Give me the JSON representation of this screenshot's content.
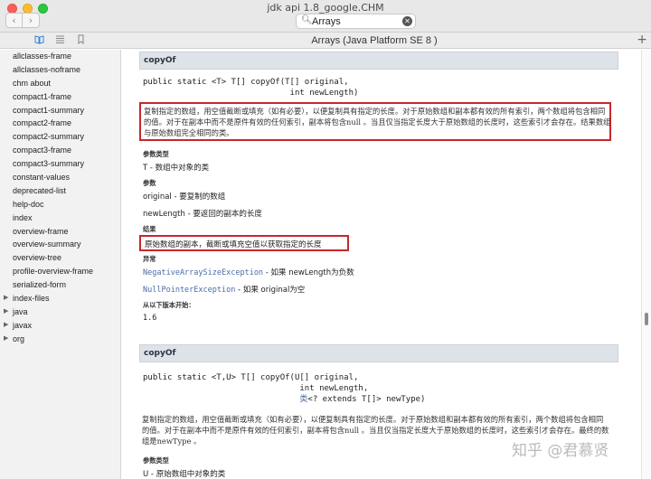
{
  "window": {
    "title": "jdk api 1.8_google.CHM",
    "traffic_light_colors": [
      "#ff5f57",
      "#febc2e",
      "#28c840"
    ]
  },
  "toolbar": {
    "back_glyph": "‹",
    "forward_glyph": "›",
    "search_value": "Arrays",
    "search_icon": "search-icon",
    "clear_icon": "clear-icon"
  },
  "tabbar": {
    "page_title": "Arrays (Java Platform SE 8 )",
    "add_glyph": "+"
  },
  "sidebar": {
    "items": [
      {
        "label": "allclasses-frame",
        "expandable": false
      },
      {
        "label": "allclasses-noframe",
        "expandable": false
      },
      {
        "label": "chm about",
        "expandable": false
      },
      {
        "label": "compact1-frame",
        "expandable": false
      },
      {
        "label": "compact1-summary",
        "expandable": false
      },
      {
        "label": "compact2-frame",
        "expandable": false
      },
      {
        "label": "compact2-summary",
        "expandable": false
      },
      {
        "label": "compact3-frame",
        "expandable": false
      },
      {
        "label": "compact3-summary",
        "expandable": false
      },
      {
        "label": "constant-values",
        "expandable": false
      },
      {
        "label": "deprecated-list",
        "expandable": false
      },
      {
        "label": "help-doc",
        "expandable": false
      },
      {
        "label": "index",
        "expandable": false
      },
      {
        "label": "overview-frame",
        "expandable": false
      },
      {
        "label": "overview-summary",
        "expandable": false
      },
      {
        "label": "overview-tree",
        "expandable": false
      },
      {
        "label": "profile-overview-frame",
        "expandable": false
      },
      {
        "label": "serialized-form",
        "expandable": false
      },
      {
        "label": "index-files",
        "expandable": true
      },
      {
        "label": "java",
        "expandable": true
      },
      {
        "label": "javax",
        "expandable": true
      },
      {
        "label": "org",
        "expandable": true
      }
    ]
  },
  "content": {
    "method1": {
      "header": "copyOf",
      "signature_line1": "public static <T> T[] copyOf(T[] original,",
      "signature_line2": "                              int newLength)",
      "description": "复制指定的数组，用空值截断或填充（如有必要），以便复制具有指定的长度。对于原始数组和副本都有效的所有索引，两个数组将包含相同的值。对于在副本中而不是原件有效的任何索引，副本将包含null 。当且仅当指定长度大于原始数组的长度时，这些索引才会存在。结果数组与原始数组完全相同的类。",
      "type_params_label": "参数类型",
      "type_param": "T - 数组中对象的类",
      "params_label": "参数",
      "param1": "original - 要复制的数组",
      "param2": "newLength - 要返回的副本的长度",
      "result_label": "结果",
      "result": "原始数组的副本，截断或填充空值以获取指定的长度",
      "throws_label": "异常",
      "throws1_name": "NegativeArraySizeException",
      "throws1_desc": " - 如果 newLength为负数",
      "throws2_name": "NullPointerException",
      "throws2_desc": " - 如果 original为空",
      "since_label": "从以下版本开始：",
      "since": "1.6"
    },
    "method2": {
      "header": "copyOf",
      "signature_line1": "public static <T,U> T[] copyOf(U[] original,",
      "signature_line2": "                                int newLength,",
      "signature_line3_link": "类",
      "signature_line3_rest": "<? extends T[]> newType)",
      "description": "复制指定的数组，用空值截断或填充（如有必要），以便复制具有指定的长度。对于原始数组和副本都有效的所有索引，两个数组将包含相同的值。对于在副本中而不是原件有效的任何索引，副本将包含null 。当且仅当指定长度大于原始数组的长度时，这些索引才会存在。最终的数组是newType 。",
      "type_params_label": "参数类型",
      "type_param": "U - 原始数组中对象的类"
    },
    "highlight_color": "#c8272b",
    "link_color": "#4a6da7"
  },
  "watermark": "知乎 @君慕贤"
}
